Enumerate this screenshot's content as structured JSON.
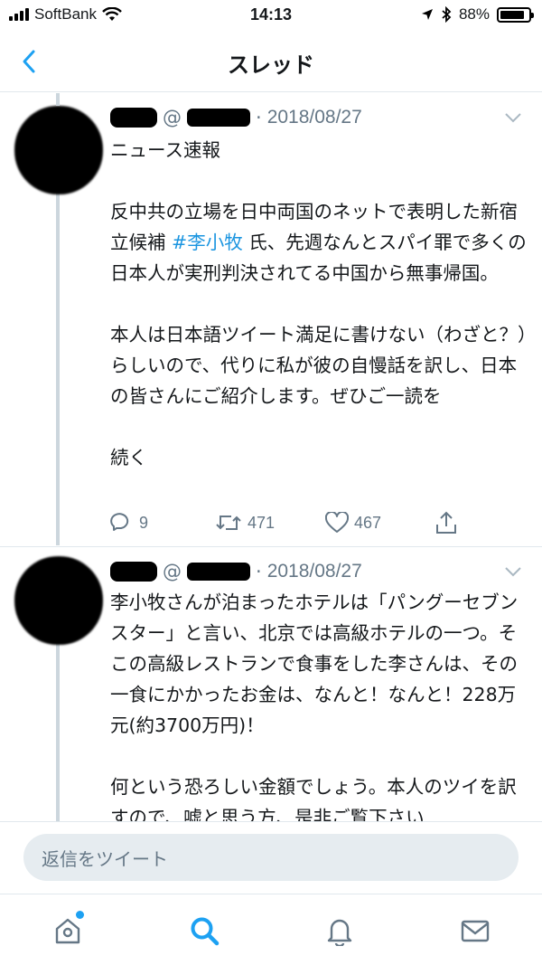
{
  "status_bar": {
    "carrier": "SoftBank",
    "time": "14:13",
    "battery": "88%",
    "battery_level": 0.88
  },
  "nav": {
    "title": "スレッド"
  },
  "tweets": [
    {
      "handle_prefix": "@",
      "separator": "·",
      "date": "2018/08/27",
      "body_before": "ニュース速報\n\n反中共の立場を日中両国のネットで表明した新宿立候補 ",
      "hashtag": "#李小牧",
      "body_after": " 氏、先週なんとスパイ罪で多くの日本人が実刑判決されてる中国から無事帰国。\n\n本人は日本語ツイート満足に書けない（わざと？）らしいので、代りに私が彼の自慢話を訳し、日本の皆さんにご紹介します。ぜひご一読を\n\n続く",
      "reply_count": "9",
      "retweet_count": "471",
      "like_count": "467"
    },
    {
      "handle_prefix": "@",
      "separator": "·",
      "date": "2018/08/27",
      "body": "李小牧さんが泊まったホテルは「パングーセブン スター」と言い、北京では高級ホテルの一つ。そこの高級レストランで食事をした李さんは、その一食にかかったお金は、なんと！なんと！228万元(約3700万円)！\n\n何という恐ろしい金額でしょう。本人のツイを訳すので、嘘と思う方、是非ご覧下さい"
    }
  ],
  "reply": {
    "placeholder": "返信をツイート"
  },
  "tabs": [
    {
      "icon": "home-icon",
      "has_badge": true
    },
    {
      "icon": "search-icon",
      "active": true
    },
    {
      "icon": "bell-icon"
    },
    {
      "icon": "mail-icon"
    }
  ],
  "colors": {
    "accent": "#1da1f2",
    "link": "#1b95e0",
    "secondary_text": "#657786",
    "divider": "#e1e8ed"
  }
}
